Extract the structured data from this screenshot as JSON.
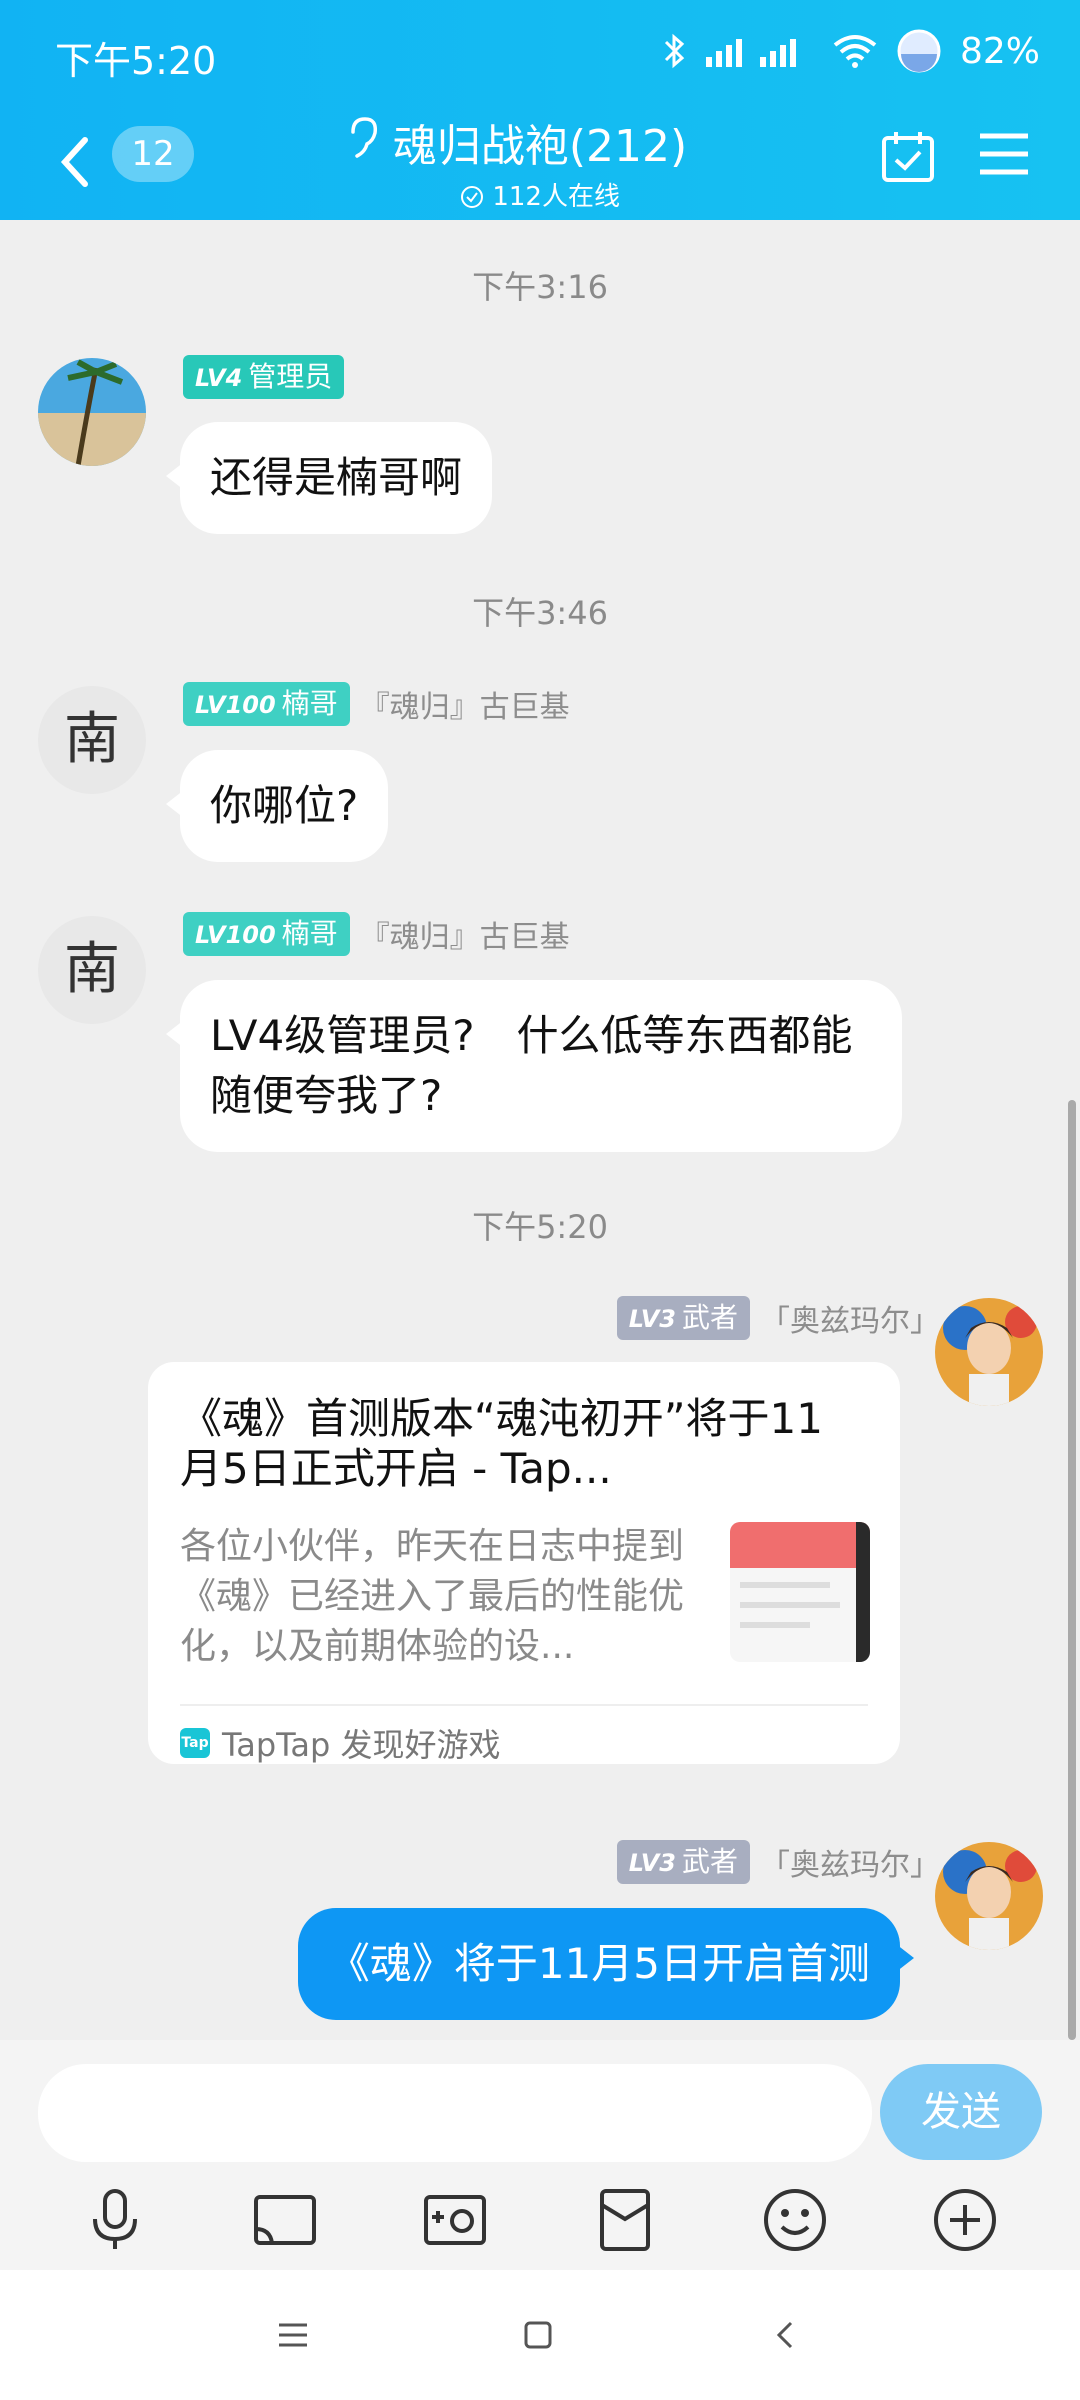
{
  "status_bar": {
    "time": "下午5:20",
    "battery": "82%"
  },
  "header": {
    "unread_count": "12",
    "group_title": "魂归战袍(212)",
    "online_text": "112人在线"
  },
  "messages": {
    "ts1": "下午3:16",
    "m1": {
      "tag_level": "LV4",
      "tag_text": "管理员",
      "text": "还得是楠哥啊"
    },
    "ts2": "下午3:46",
    "m2": {
      "tag_level": "LV100",
      "tag_text": "楠哥",
      "nickname": "『魂归』古巨基",
      "text": "你哪位?"
    },
    "m3": {
      "tag_level": "LV100",
      "tag_text": "楠哥",
      "nickname": "『魂归』古巨基",
      "text": "LV4级管理员?　什么低等东西都能随便夸我了?"
    },
    "ts3": "下午5:20",
    "m4": {
      "tag_level": "LV3",
      "tag_text": "武者",
      "nickname": "「奥兹玛尔」",
      "card_title": "《魂》首测版本“魂沌初开”将于11月5日正式开启 - Tap...",
      "card_desc": "各位小伙伴，昨天在日志中提到《魂》已经进入了最后的性能优化，以及前期体验的设...",
      "card_source": "TapTap 发现好游戏"
    },
    "m5": {
      "tag_level": "LV3",
      "tag_text": "武者",
      "nickname": "「奥兹玛尔」",
      "text": "《魂》将于11月5日开启首测"
    }
  },
  "input_bar": {
    "send_label": "发送"
  },
  "avatar_initial": "南",
  "colors": {
    "header": "#11b3f3",
    "bubble_blue": "#0e97f4",
    "send_disabled": "#7fcaf5"
  }
}
